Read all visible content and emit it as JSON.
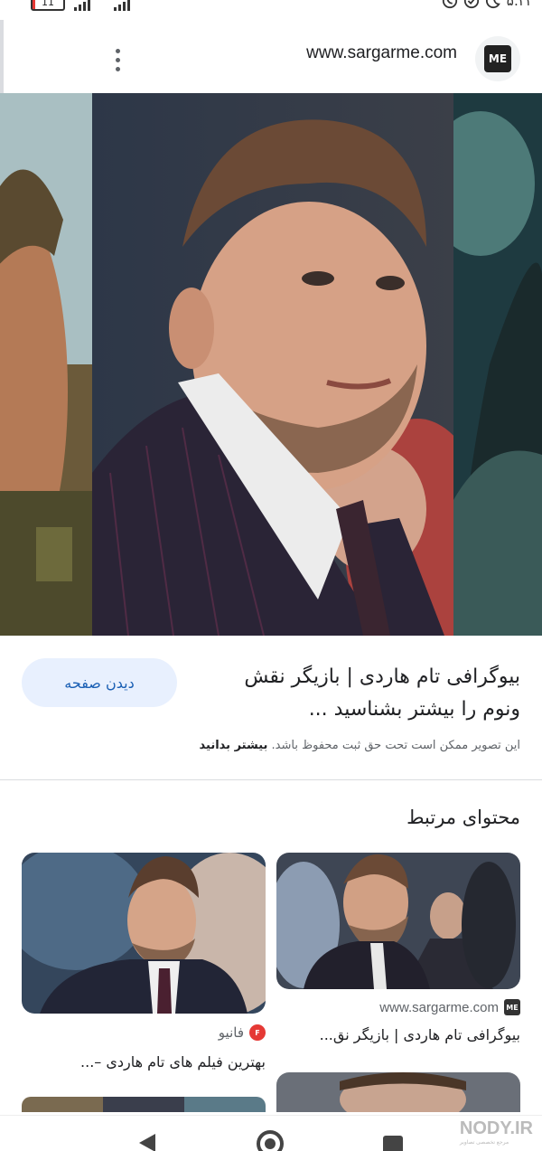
{
  "status_bar": {
    "battery": "11",
    "network": "4G",
    "time": "۵:۲۲",
    "icons": [
      "whatsapp-icon",
      "check-circle-icon",
      "moon-icon"
    ]
  },
  "header": {
    "url": "www.sargarme.com",
    "logo_text": "ME",
    "menu_icon": "more-vert-icon"
  },
  "result": {
    "title": "بیوگرافی تام هاردی | بازیگر نقش ونوم را بیشتر بشناسید ...",
    "visit_button": "دیدن صفحه",
    "copyright_text": "این تصویر ممکن است تحت حق ثبت محفوظ باشد.",
    "learn_more": "بیشتر بدانید"
  },
  "related": {
    "heading": "محتوای مرتبط",
    "cards": [
      {
        "source": "www.sargarme.com",
        "favicon": "ME",
        "title": "بیوگرافی تام هاردی | بازیگر نق..."
      },
      {
        "source": "فانیو",
        "favicon": "F",
        "title": "بهترین فیلم های تام هاردی –..."
      }
    ]
  },
  "nav": {
    "back_icon": "back-triangle-icon",
    "home_icon": "home-circle-icon",
    "recent_icon": "recent-square-icon"
  },
  "watermark": {
    "text": "NODY.IR",
    "sub": "مرجع تخصصی تصاویر"
  },
  "colors": {
    "accent": "#1a5fb4",
    "button_bg": "#e8f0fe",
    "text": "#202124",
    "muted": "#5f6368"
  }
}
